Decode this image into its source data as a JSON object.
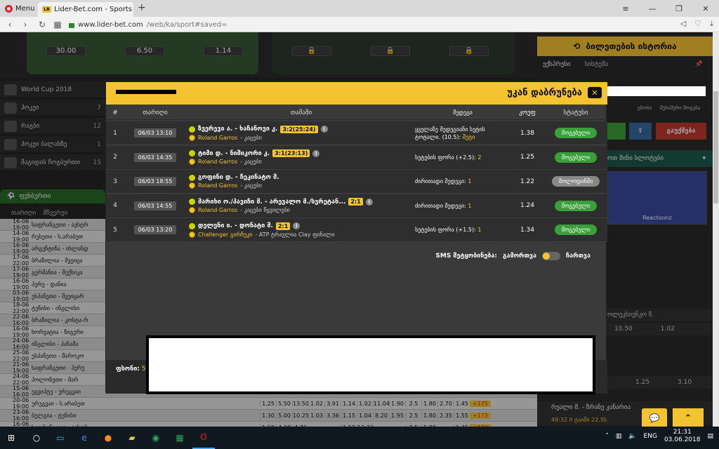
{
  "browser": {
    "menu_label": "Menu",
    "tab_title": "Lider-Bet.com - Sports and",
    "favicon_text": "LB",
    "url_host": "www.lider-bet.com",
    "url_path": "/web/ka/sport#saved="
  },
  "background": {
    "odds": [
      "30.00",
      "6.50",
      "1.14"
    ],
    "history_button": "ბილეთების ისტორია",
    "right_tabs": [
      "ექსპრესი",
      "სისტემა"
    ],
    "sidebar": [
      {
        "label": "World Cup 2018",
        "count": ""
      },
      {
        "label": "ჰოკეი",
        "count": "7"
      },
      {
        "label": "რაგბი",
        "count": "12"
      },
      {
        "label": "ჰოკეი ბალახზე",
        "count": "1"
      },
      {
        "label": "მაგიდის ჩოგბურთი",
        "count": "15"
      }
    ],
    "sport_tab": "ფეხბურთი",
    "table_header": [
      "თარიღი",
      "მწვერვი"
    ],
    "rows": [
      {
        "date": "16-06 19:00",
        "team": "საფრანგეთი - ავსტრ"
      },
      {
        "date": "14-06 19:00",
        "team": "რუსეთი - ს.არაბეთ"
      },
      {
        "date": "16-06 19:00",
        "team": "არგენტინა - ისლანდ"
      },
      {
        "date": "17-06 22:00",
        "team": "ბრაზილია - შვეიცა"
      },
      {
        "date": "17-06 19:00",
        "team": "გერმანია - მექსიკა"
      },
      {
        "date": "16-06 19:00",
        "team": "პერუ - დანია"
      },
      {
        "date": "03-06 19:00",
        "team": "ესპანეთი - შვეიცარ"
      },
      {
        "date": "18-06 22:00",
        "team": "ტუნისი - ინგლისი"
      },
      {
        "date": "22-06 16:00",
        "team": "ბრაზილია - კოსტა-რ"
      },
      {
        "date": "16-06 19:00",
        "team": "ხორვატია - ნიგერი"
      },
      {
        "date": "24-06 16:00",
        "team": "ინგლისი - პანამა"
      },
      {
        "date": "25-06 22:00",
        "team": "ესპანეთი - მაროკო"
      },
      {
        "date": "21-06 19:00",
        "team": "საფრანგეთი - პერუ"
      },
      {
        "date": "24-06 22:00",
        "team": "პოლონეთი - მარ"
      },
      {
        "date": "15-06 16:00",
        "team": "ეგვიპტე - ურუგვაი"
      },
      {
        "date": "20-06 19:00",
        "team": "ურუგვაი - ს.არაბეთ",
        "odds": [
          "1.25",
          "5.50",
          "13.50",
          "1.02",
          "3.91",
          "1.14",
          "1.02",
          "11.04",
          "1.90",
          "2.5",
          "1.80",
          "2.70",
          "1.45"
        ],
        "plus": "+175"
      },
      {
        "date": "23-06 16:00",
        "team": "ბელგია - ტუნისი",
        "odds": [
          "1.30",
          "5.00",
          "10.25",
          "1.03",
          "3.36",
          "1.15",
          "1.04",
          "8.20",
          "1.95",
          "2.5",
          "1.80",
          "2.35",
          "1.55"
        ],
        "plus": "+173"
      },
      {
        "date": "16-06 16:00",
        "team": "საფრანგეთი - ავსტრ",
        "odds": [
          "1.50",
          "4.20",
          "4.76",
          "",
          "",
          "1.12",
          "13.33",
          "",
          "",
          "2.5",
          "1.80",
          "",
          "1.45"
        ],
        "plus": "+174"
      }
    ],
    "right_buttons": [
      "გაუქმება"
    ],
    "slots_label": "ოთ მინი სლოტები",
    "slot_game": "Reactoonz",
    "right_small_labels": [
      "ცნობა",
      "მუხამერი მოგება"
    ],
    "right_lines": [
      "ოლეკსიენკო ზ.",
      "10.50",
      "1.02",
      "1.25",
      "3.10"
    ],
    "right_match": "რეალი მ. - ზრანე კანარია",
    "right_match_time": "49:32 II ტაიმი 22.5ს"
  },
  "modal": {
    "back_label": "უკან დაბრუნება",
    "columns": [
      "#",
      "თარიღი",
      "თამაში",
      "შედეგი",
      "კოეფ",
      "სტატუსი"
    ],
    "rows": [
      {
        "num": "1",
        "date": "06/03 13:10",
        "match": "ზვერევი ა. - ხაჩანოვი კ.",
        "score": "3:2(25:24)",
        "info": true,
        "tournament": "Roland Garros",
        "category": "- კაცები",
        "outcome": "ყველაზე შედეგიანი სეტის ტოტალი. (10.5):",
        "outcome_val": "მეტი",
        "coef": "1.38",
        "status": "მოგებული",
        "status_type": "win"
      },
      {
        "num": "2",
        "date": "06/03 14:35",
        "match": "ტიმი დ. - ნიშიკორი კ.",
        "score": "3:1(23:13)",
        "info": true,
        "tournament": "Roland Garros",
        "category": "- კაცები",
        "outcome": "სეტების ფორა (+2.5):",
        "outcome_val": "2",
        "coef": "1.25",
        "status": "მოგებული",
        "status_type": "win"
      },
      {
        "num": "3",
        "date": "06/03 18:55",
        "match": "გოფინი დ. - ჩეკინატო მ.",
        "score": "",
        "info": false,
        "tournament": "Roland Garros",
        "category": "- კაცები",
        "outcome": "ძირითადი შედეგი:",
        "outcome_val": "1",
        "coef": "1.22",
        "status": "მოლოდინში",
        "status_type": "wait"
      },
      {
        "num": "4",
        "date": "06/03 14:55",
        "match": "მარიხი ო./პავიჩი მ. - არევალო მ./სერეტან...",
        "score": "2:1",
        "info": true,
        "tournament": "Roland Garros",
        "category": "- კაცები წყვილები",
        "outcome": "ძირითადი შედეგი:",
        "outcome_val": "1",
        "coef": "1.24",
        "status": "მოგებული",
        "status_type": "win"
      },
      {
        "num": "5",
        "date": "06/03 13:20",
        "match": "დელენი ი. - დონატი მ.",
        "score": "2:1",
        "info": true,
        "tournament": "Challenger გირჩეკი",
        "category": "- ATP ტრავლია Clay ფინალი",
        "outcome": "სეტების ფორა (+1.5):",
        "outcome_val": "1",
        "coef": "1.34",
        "status": "მოგებული",
        "status_type": "win"
      }
    ],
    "sms_label": "SMS შეტყობინება:",
    "sms_on": "გამორთვა",
    "sms_off": "ჩართვა",
    "balance_label": "ფსონი:",
    "balance_value": "5"
  },
  "taskbar": {
    "lang": "ENG",
    "time": "21:31",
    "date": "03.06.2018"
  }
}
